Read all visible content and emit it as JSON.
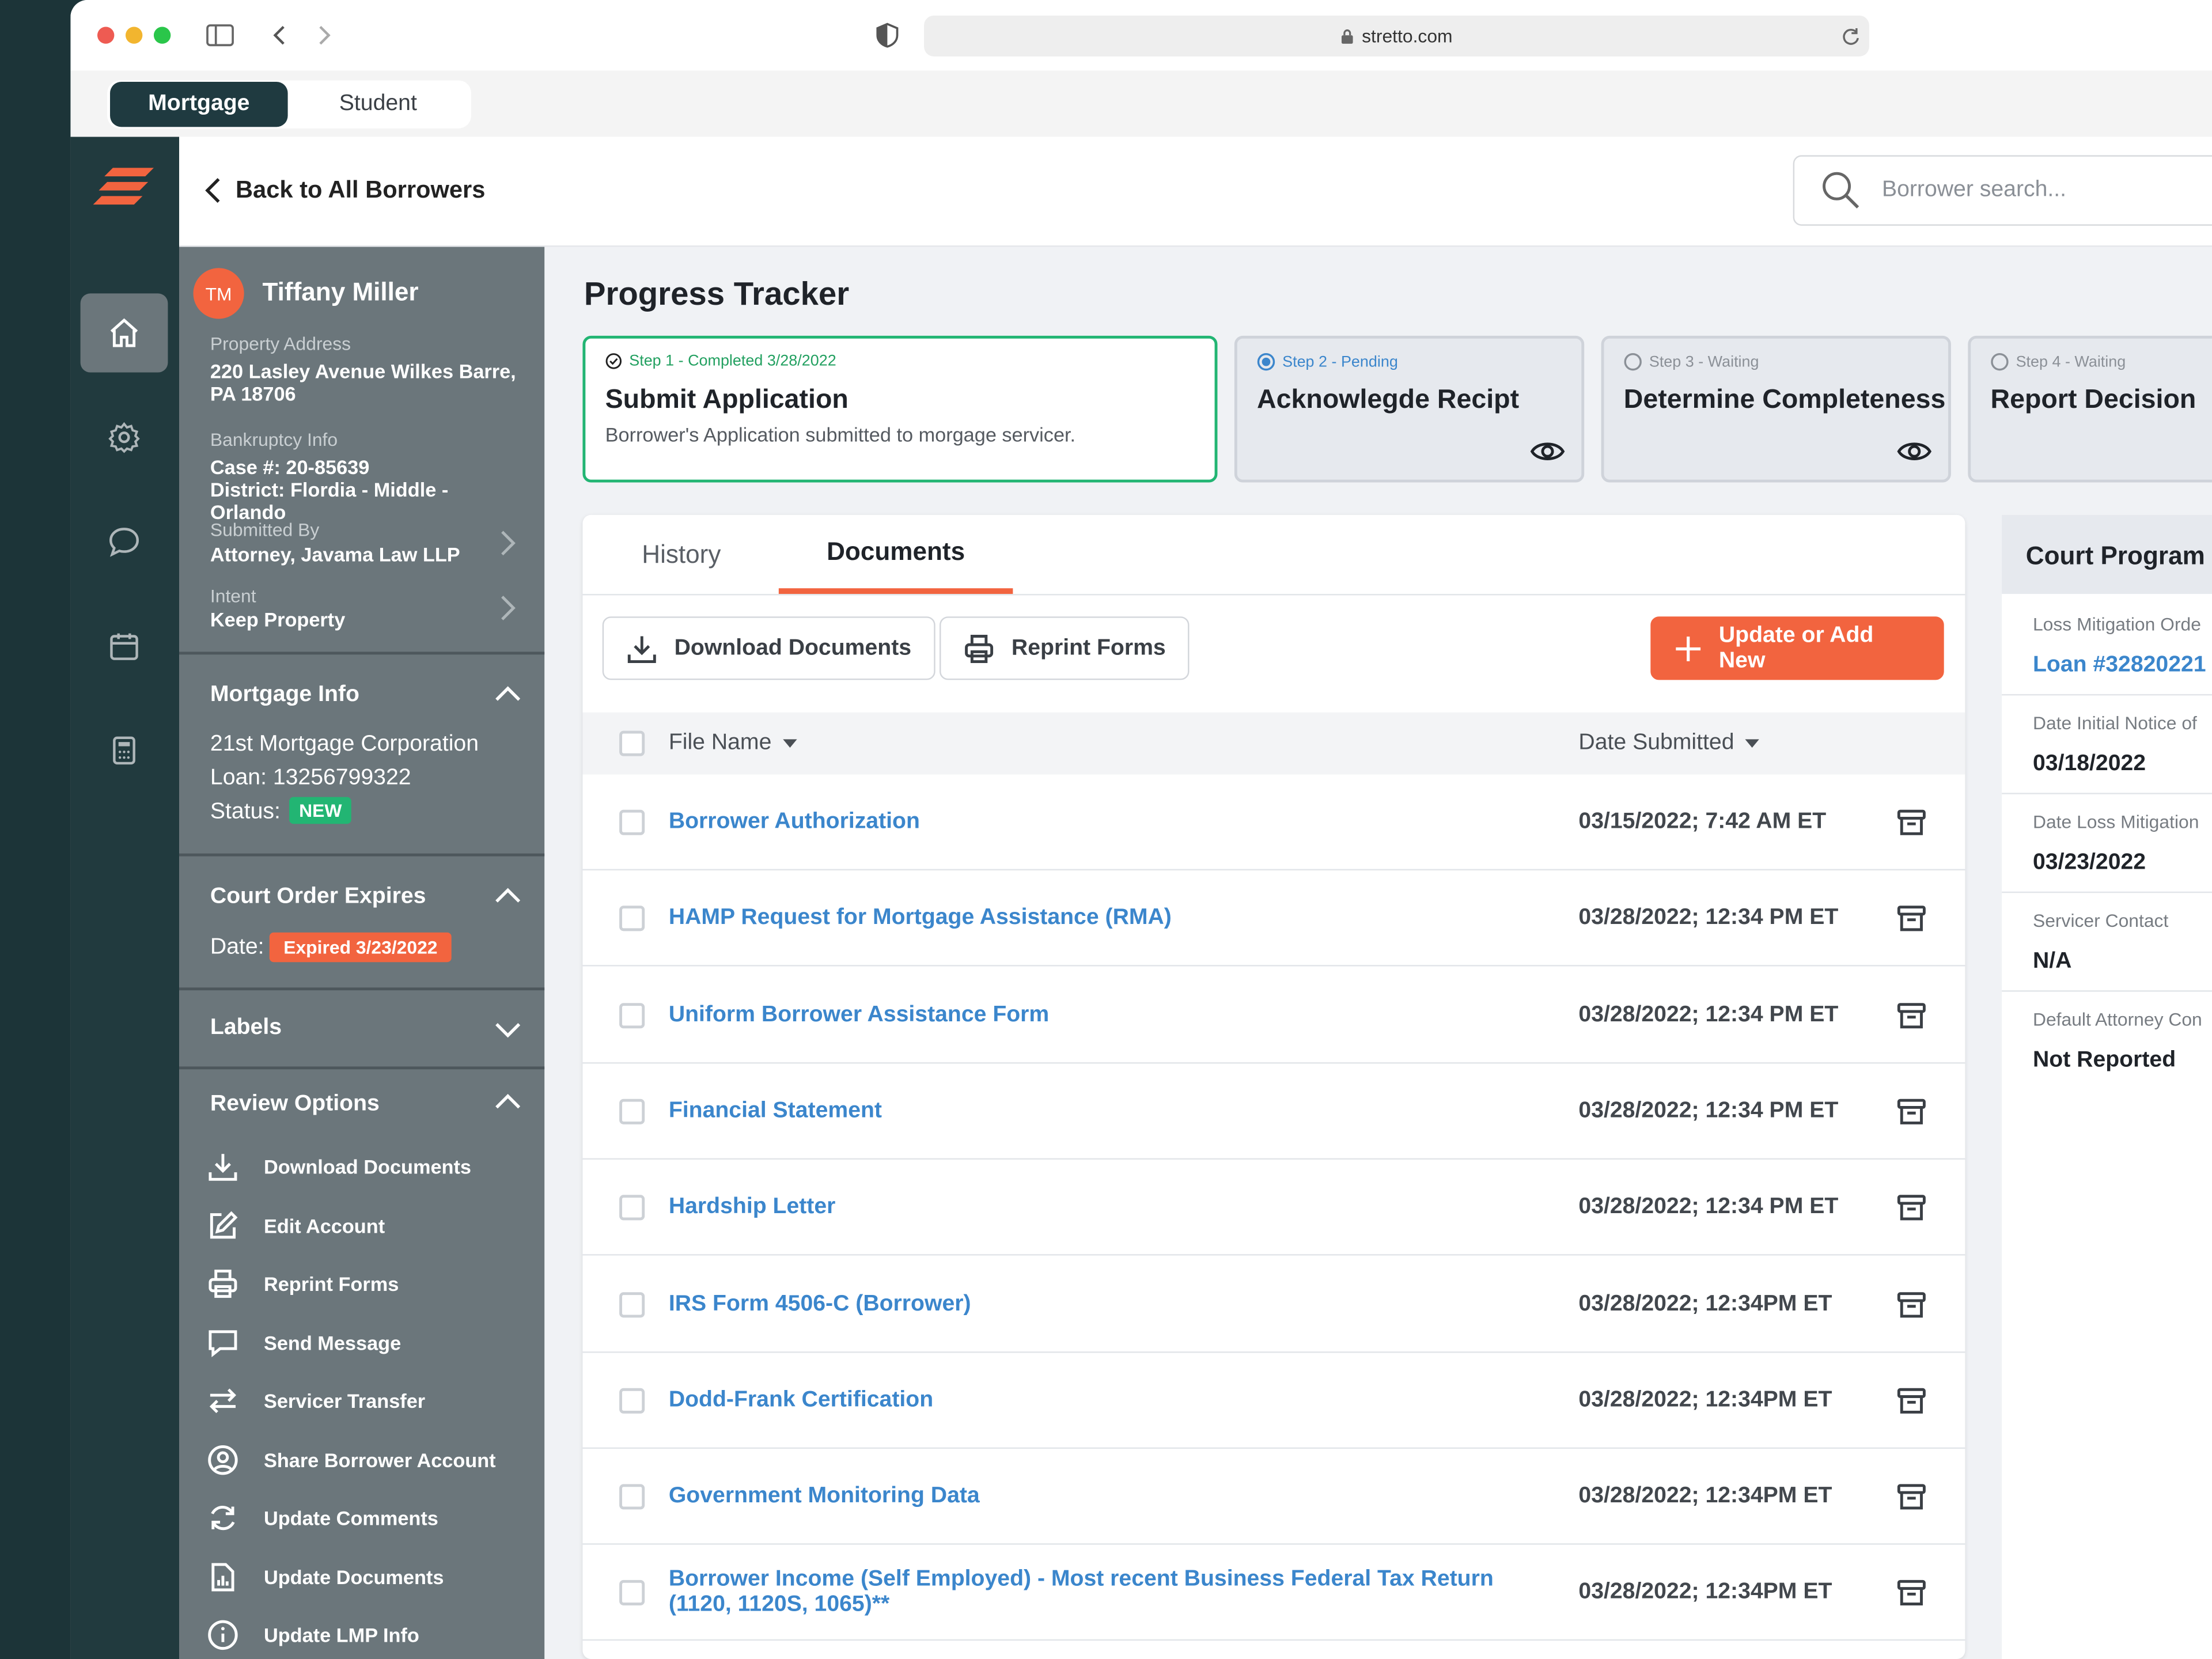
{
  "browser": {
    "url": "stretto.com"
  },
  "app_tabs": [
    "Mortgage",
    "Student"
  ],
  "topbar": {
    "back_label": "Back to All Borrowers",
    "search_placeholder": "Borrower search..."
  },
  "borrower": {
    "initials": "TM",
    "name": "Tiffany Miller",
    "property_label": "Property Address",
    "property_line1": "220 Lasley Avenue Wilkes Barre,",
    "property_line2": "PA 18706",
    "bankruptcy_label": "Bankruptcy Info",
    "case": "Case #: 20-85639",
    "district_line1": "District: Flordia - Middle -",
    "district_line2": "Orlando",
    "submitted_label": "Submitted By",
    "submitted_by": "Attorney, Javama Law LLP",
    "intent_label": "Intent",
    "intent": "Keep Property"
  },
  "mortgage_info": {
    "title": "Mortgage Info",
    "company": "21st Mortgage Corporation",
    "loan": "Loan: 13256799322",
    "status_label": "Status:",
    "status": "NEW"
  },
  "court_order": {
    "title": "Court Order Expires",
    "date_label": "Date:",
    "badge": "Expired 3/23/2022"
  },
  "labels_section": {
    "title": "Labels"
  },
  "review_options": {
    "title": "Review Options",
    "items": [
      {
        "label": "Download Documents",
        "icon": "download-icon"
      },
      {
        "label": "Edit Account",
        "icon": "edit-icon"
      },
      {
        "label": "Reprint Forms",
        "icon": "printer-icon"
      },
      {
        "label": "Send Message",
        "icon": "message-icon"
      },
      {
        "label": "Servicer Transfer",
        "icon": "transfer-icon"
      },
      {
        "label": "Share Borrower Account",
        "icon": "user-circle-icon"
      },
      {
        "label": "Update Comments",
        "icon": "refresh-icon"
      },
      {
        "label": "Update Documents",
        "icon": "document-chart-icon"
      },
      {
        "label": "Update LMP Info",
        "icon": "info-icon"
      }
    ]
  },
  "progress": {
    "title": "Progress Tracker",
    "steps": [
      {
        "tag": "Step 1 - Completed 3/28/2022",
        "title": "Submit Application",
        "desc": "Borrower's Application submitted to morgage servicer."
      },
      {
        "tag": "Step 2 - Pending",
        "title": "Acknowlegde Recipt"
      },
      {
        "tag": "Step 3 - Waiting",
        "title": "Determine Completeness"
      },
      {
        "tag": "Step 4 - Waiting",
        "title": "Report Decision"
      }
    ]
  },
  "documents": {
    "tabs": [
      "History",
      "Documents"
    ],
    "download_btn": "Download Documents",
    "reprint_btn": "Reprint Forms",
    "add_btn": "Update or Add New",
    "col_file": "File Name",
    "col_date": "Date Submitted",
    "rows": [
      {
        "name": "Borrower Authorization",
        "date": "03/15/2022; 7:42 AM ET"
      },
      {
        "name": "HAMP Request for Mortgage Assistance (RMA)",
        "date": "03/28/2022; 12:34 PM ET"
      },
      {
        "name": "Uniform Borrower Assistance Form",
        "date": "03/28/2022; 12:34 PM ET"
      },
      {
        "name": "Financial Statement",
        "date": "03/28/2022; 12:34 PM ET"
      },
      {
        "name": "Hardship Letter",
        "date": "03/28/2022; 12:34 PM ET"
      },
      {
        "name": "IRS Form 4506-C (Borrower)",
        "date": "03/28/2022; 12:34PM ET"
      },
      {
        "name": "Dodd-Frank Certification",
        "date": "03/28/2022; 12:34PM ET"
      },
      {
        "name": "Government Monitoring Data",
        "date": "03/28/2022; 12:34PM ET"
      },
      {
        "name": "Borrower Income (Self Employed) - Most recent Business Federal Tax Return (1120, 1120S, 1065)**",
        "date": "03/28/2022; 12:34PM ET"
      }
    ]
  },
  "court_program": {
    "title": "Court Program",
    "fields": [
      {
        "label": "Loss Mitigation Orde",
        "value": "Loan #32820221"
      },
      {
        "label": "Date Initial Notice of",
        "value": "03/18/2022"
      },
      {
        "label": "Date Loss Mitigation",
        "value": "03/23/2022"
      },
      {
        "label": "Servicer Contact",
        "value": "N/A"
      },
      {
        "label": "Default Attorney Con",
        "value": "Not Reported"
      }
    ]
  },
  "colors": {
    "accent": "#f2643f",
    "nav_bg": "#213a3e",
    "sidebar_bg": "#6b767b",
    "link": "#3b86cc",
    "success": "#22b573"
  }
}
